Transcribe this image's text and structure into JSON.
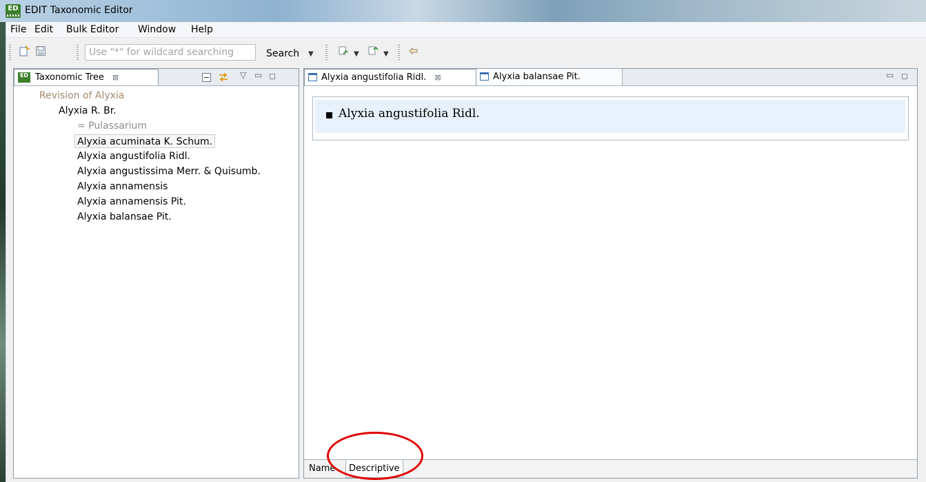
{
  "window": {
    "title": "EDIT Taxonomic Editor",
    "app_icon_text": "ED"
  },
  "menubar": {
    "items": [
      "File",
      "Edit",
      "Bulk Editor",
      "Window",
      "Help"
    ]
  },
  "toolbar": {
    "search_placeholder": "Use \"*\" for wildcard searching",
    "search_label": "Search",
    "icons": [
      "new-icon",
      "save-icon",
      "open-parent-icon",
      "open-child-icon",
      "link-icon"
    ]
  },
  "tree_panel": {
    "tab_title": "Taxonomic Tree",
    "nodes": [
      {
        "label": "Revision of Alyxia",
        "level": 0,
        "kind": "root"
      },
      {
        "label": "Alyxia R. Br.",
        "level": 1,
        "kind": "taxon"
      },
      {
        "label": "= Pulassarium",
        "level": 2,
        "kind": "synonym"
      },
      {
        "label": "Alyxia acuminata K. Schum.",
        "level": 2,
        "kind": "taxon",
        "selected": true
      },
      {
        "label": "Alyxia angustifolia Ridl.",
        "level": 2,
        "kind": "taxon"
      },
      {
        "label": "Alyxia angustissima Merr. & Quisumb.",
        "level": 2,
        "kind": "taxon"
      },
      {
        "label": "Alyxia annamensis",
        "level": 2,
        "kind": "taxon"
      },
      {
        "label": "Alyxia annamensis Pit.",
        "level": 2,
        "kind": "taxon"
      },
      {
        "label": "Alyxia balansae Pit.",
        "level": 2,
        "kind": "taxon"
      }
    ]
  },
  "editor": {
    "tabs": [
      {
        "label": "Alyxia angustifolia Ridl.",
        "active": true
      },
      {
        "label": "Alyxia balansae Pit.",
        "active": false
      }
    ],
    "accepted_name": "Alyxia angustifolia Ridl.",
    "bottom_tabs": [
      {
        "label": "Name",
        "selected": false
      },
      {
        "label": "Descriptive",
        "selected": true
      }
    ]
  },
  "colors": {
    "highlight_circle": "#e00000",
    "root_node": "#a4886a",
    "synonym_node": "#8d8d8d",
    "name_line_bg": "#e8f1fb"
  }
}
